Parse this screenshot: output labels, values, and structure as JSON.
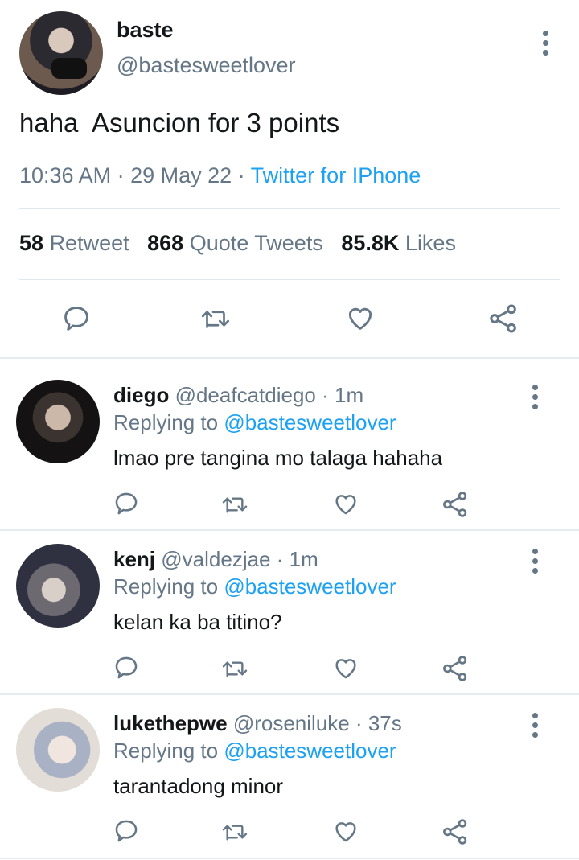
{
  "tweet": {
    "name": "baste",
    "handle": "@bastesweetlover",
    "text": "haha  Asuncion for 3 points",
    "time": "10:36 AM",
    "date": "29 May 22",
    "source": "Twitter for IPhone",
    "stats": {
      "retweet_count": "58",
      "retweet_label": "Retweet",
      "quote_count": "868",
      "quote_label": "Quote Tweets",
      "likes_count": "85.8K",
      "likes_label": "Likes"
    }
  },
  "replies": [
    {
      "name": "diego",
      "handle": "@deafcatdiego",
      "time": "1m",
      "replying_label": "Replying to",
      "replying_to": "@bastesweetlover",
      "text": "lmao pre tangina mo talaga hahaha"
    },
    {
      "name": "kenj",
      "handle": "@valdezjae",
      "time": "1m",
      "replying_label": "Replying to",
      "replying_to": "@bastesweetlover",
      "text": "kelan ka ba titino?"
    },
    {
      "name": "lukethepwe",
      "handle": "@roseniluke",
      "time": "37s",
      "replying_label": "Replying to",
      "replying_to": "@bastesweetlover",
      "text": "tarantadong minor"
    }
  ],
  "colors": {
    "accent": "#1da1f2",
    "secondary_text": "#657786",
    "divider": "#e1e8ed"
  },
  "icons": [
    "comment-icon",
    "retweet-icon",
    "heart-icon",
    "share-icon",
    "more-options-icon"
  ]
}
